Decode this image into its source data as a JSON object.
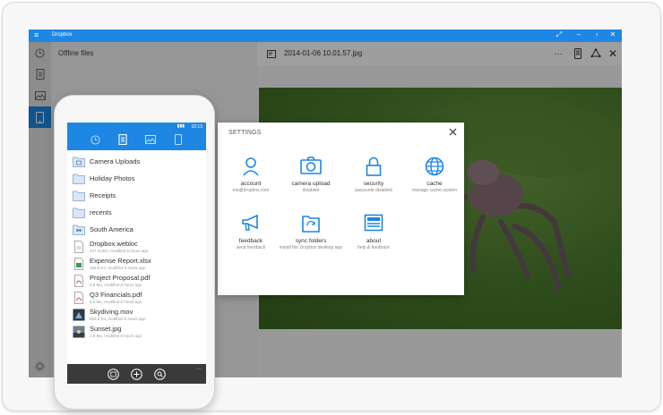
{
  "app": {
    "title": "Dropbox",
    "menu_icon": "hamburger-icon",
    "window_controls": [
      "fullscreen-icon",
      "minimize-icon",
      "restore-icon",
      "close-icon"
    ]
  },
  "rail": {
    "items": [
      {
        "icon": "clock-icon",
        "active": false
      },
      {
        "icon": "document-icon",
        "active": false
      },
      {
        "icon": "photo-icon",
        "active": false
      },
      {
        "icon": "phone-icon",
        "active": true
      }
    ],
    "footer_icon": "gear-icon"
  },
  "list_pane": {
    "title": "Offline files"
  },
  "viewer": {
    "file_name": "2014-01-06 10.01.57.jpg",
    "actions": [
      "more-icon",
      "phone-sync-icon",
      "share-icon",
      "close-icon"
    ]
  },
  "settings": {
    "title": "SETTINGS",
    "tiles": [
      {
        "label": "account",
        "sub": "me@dropbox.com",
        "icon": "person-icon"
      },
      {
        "label": "camera upload",
        "sub": "disabled",
        "icon": "camera-icon"
      },
      {
        "label": "security",
        "sub": "passcode disabled",
        "icon": "lock-icon"
      },
      {
        "label": "cache",
        "sub": "manage cache system",
        "icon": "globe-icon"
      },
      {
        "label": "feedback",
        "sub": "send feedback",
        "icon": "megaphone-icon"
      },
      {
        "label": "sync folders",
        "sub": "install the Dropbox desktop app",
        "icon": "sync-folder-icon"
      },
      {
        "label": "about",
        "sub": "help & feedback",
        "icon": "newspaper-icon"
      }
    ]
  },
  "phone": {
    "status_time": "10:13",
    "tabs": [
      "clock-icon",
      "document-icon",
      "photo-icon",
      "phone-icon"
    ],
    "active_tab": 1,
    "items": [
      {
        "name": "Camera Uploads",
        "type": "folder-camera",
        "sub": ""
      },
      {
        "name": "Holiday Photos",
        "type": "folder",
        "sub": ""
      },
      {
        "name": "Receipts",
        "type": "folder",
        "sub": ""
      },
      {
        "name": "recents",
        "type": "folder",
        "sub": ""
      },
      {
        "name": "South America",
        "type": "folder-shared",
        "sub": ""
      },
      {
        "name": "Dropbox.webloc",
        "type": "file",
        "sub": "247 octets, modified 5 hours ago"
      },
      {
        "name": "Expense Report.xlsx",
        "type": "excel",
        "sub": "166.8 Ko, modified 5 hours ago"
      },
      {
        "name": "Project Proposal.pdf",
        "type": "pdf",
        "sub": "2.6 Mo, modified 5 hours ago"
      },
      {
        "name": "Q3 Financials.pdf",
        "type": "pdf",
        "sub": "5.5 Mo, modified 5 hours ago"
      },
      {
        "name": "Skydiving.mov",
        "type": "video",
        "sub": "553.6 Ko, modified 5 hours ago"
      },
      {
        "name": "Sunset.jpg",
        "type": "image",
        "sub": "1.5 Mo, modified 5 hours ago"
      }
    ],
    "bottom_actions": [
      "select-icon",
      "add-icon",
      "search-icon"
    ],
    "more_label": "..."
  },
  "colors": {
    "accent": "#1e86e3",
    "rail": "#e3e3e3",
    "pane": "#f2f2f2",
    "appbar": "#3a3a3a"
  }
}
